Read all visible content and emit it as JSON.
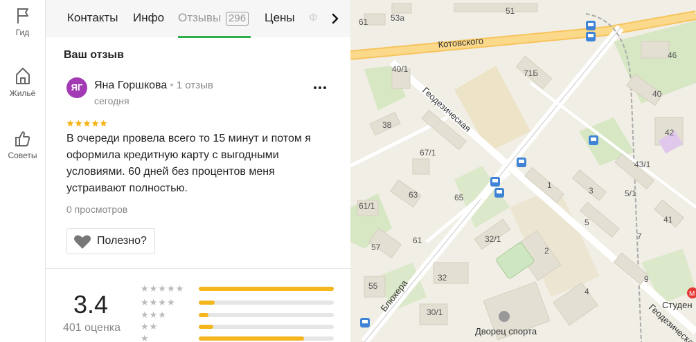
{
  "rail": {
    "items": [
      {
        "label": "Гид",
        "icon": "flag-icon"
      },
      {
        "label": "Жильё",
        "icon": "house-icon"
      },
      {
        "label": "Советы",
        "icon": "thumbs-up-icon"
      }
    ]
  },
  "tabs": {
    "items": [
      {
        "label": "Контакты"
      },
      {
        "label": "Инфо"
      },
      {
        "label": "Отзывы",
        "count": "296",
        "active": true
      },
      {
        "label": "Цены"
      },
      {
        "label": "Ф"
      }
    ],
    "next_icon": "chevron-right-icon"
  },
  "review": {
    "section_title": "Ваш отзыв",
    "avatar_initials": "ЯГ",
    "avatar_color": "#a23ab4",
    "author": "Яна Горшкова",
    "author_reviews": "1 отзыв",
    "date": "сегодня",
    "stars": 5,
    "text": "В очереди провела всего то 15 минут и потом я оформила кредитную карту с выгодными условиями. 60 дней без процентов меня устраивают полностью.",
    "views": "0 просмотров",
    "useful_label": "Полезно?"
  },
  "rating": {
    "value": "3.4",
    "count": "401 оценка",
    "bars": [
      {
        "stars": 5,
        "fraction": 1.0
      },
      {
        "stars": 4,
        "fraction": 0.12
      },
      {
        "stars": 3,
        "fraction": 0.07
      },
      {
        "stars": 2,
        "fraction": 0.11
      },
      {
        "stars": 1,
        "fraction": 0.78
      }
    ],
    "bar_color": "#f5b51d"
  },
  "map": {
    "streets": [
      "Котовского",
      "Геодезическая",
      "Блюхера",
      "Геодезическая"
    ],
    "poi": [
      "Дворец спорта",
      "Студен"
    ],
    "house_numbers": [
      "61",
      "53а",
      "51",
      "46",
      "40/1",
      "71Б",
      "40",
      "38",
      "42",
      "67/1",
      "43/1",
      "1",
      "3",
      "5/1",
      "63",
      "65",
      "61/1",
      "5",
      "41",
      "32/1",
      "7",
      "57",
      "61",
      "2",
      "55",
      "32",
      "9",
      "30/1",
      "4"
    ]
  },
  "colors": {
    "accent_green": "#2fb04a",
    "star_yellow": "#f5b51d"
  }
}
